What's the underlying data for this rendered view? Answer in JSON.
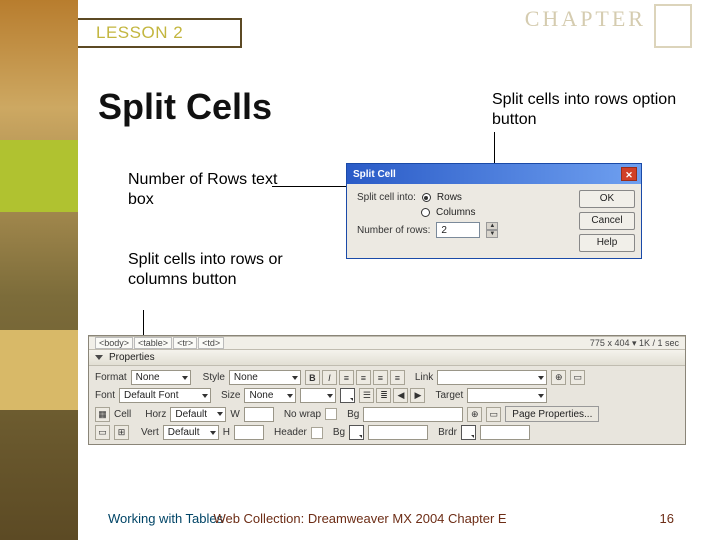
{
  "header": {
    "lesson_label": "LESSON 2",
    "chapter_word": "CHAPTER"
  },
  "title": "Split Cells",
  "callouts": {
    "rows_option": "Split cells into rows option button",
    "num_rows": "Number of Rows text box",
    "split_button": "Split cells into rows or columns button"
  },
  "dialog": {
    "title": "Split Cell",
    "label_split_into": "Split cell into:",
    "option_rows": "Rows",
    "option_columns": "Columns",
    "label_num_rows": "Number of rows:",
    "num_rows_value": "2",
    "btn_ok": "OK",
    "btn_cancel": "Cancel",
    "btn_help": "Help"
  },
  "status": {
    "tags": [
      "<body>",
      "<table>",
      "<tr>",
      "<td>"
    ],
    "right": "775 x 404 ▾ 1K / 1 sec"
  },
  "properties": {
    "panel_title": "Properties",
    "row1": {
      "format_label": "Format",
      "format_value": "None",
      "style_label": "Style",
      "style_value": "None",
      "link_label": "Link",
      "link_value": ""
    },
    "row2": {
      "font_label": "Font",
      "font_value": "Default Font",
      "size_label": "Size",
      "size_value": "None",
      "target_label": "Target",
      "target_value": ""
    },
    "row3": {
      "cell_label": "Cell",
      "horz_label": "Horz",
      "horz_value": "Default",
      "w_label": "W",
      "w_value": "",
      "nowrap_label": "No wrap",
      "bg_label": "Bg",
      "bg_value": "",
      "page_props": "Page Properties..."
    },
    "row4": {
      "vert_label": "Vert",
      "vert_value": "Default",
      "h_label": "H",
      "h_value": "",
      "header_label": "Header",
      "bg2_label": "Bg",
      "brdr_label": "Brdr"
    }
  },
  "footer": {
    "left": "Working with Tables",
    "mid": "Web Collection: Dreamweaver MX 2004 Chapter E",
    "page": "16"
  }
}
